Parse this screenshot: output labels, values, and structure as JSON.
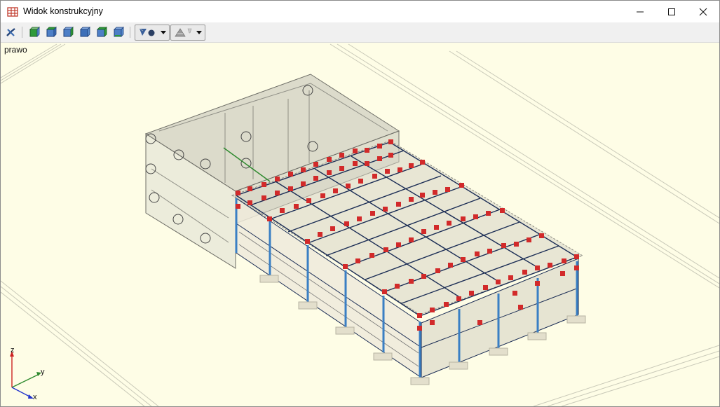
{
  "window": {
    "title": "Widok konstrukcyjny",
    "icon": "structure-grid-icon",
    "controls": [
      "minimize-icon",
      "maximize-icon",
      "close-icon"
    ]
  },
  "toolbar": {
    "buttons": [
      {
        "name": "view-direction-button",
        "icon": "axis-direction-icon"
      },
      {
        "name": "view-cube-front-button",
        "icon": "cube-front-icon"
      },
      {
        "name": "view-cube-top-button",
        "icon": "cube-top-icon"
      },
      {
        "name": "view-cube-side-button",
        "icon": "cube-side-icon"
      },
      {
        "name": "view-cube-back-button",
        "icon": "cube-back-icon"
      },
      {
        "name": "view-cube-iso-button",
        "icon": "cube-iso-icon"
      },
      {
        "name": "view-cube-bottom-button",
        "icon": "cube-bottom-icon"
      }
    ],
    "dropdowns": [
      {
        "name": "render-mode-dropdown",
        "icon": "render-solid-icon"
      },
      {
        "name": "display-options-dropdown",
        "icon": "lighting-icon"
      }
    ]
  },
  "viewport": {
    "view_label": "prawo",
    "axes": {
      "z": "z",
      "y": "y",
      "x": "x"
    },
    "colors": {
      "background": "#fefde6",
      "node": "#d22a2a",
      "member": "#1b2d55",
      "column": "#3a7fc4",
      "axis_x": "#2233cc",
      "axis_y": "#2f8a2f",
      "axis_z": "#cc2222"
    }
  }
}
